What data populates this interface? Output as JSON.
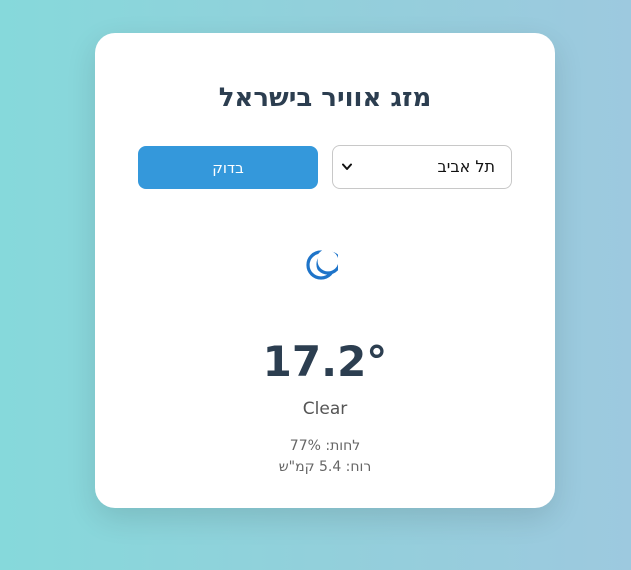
{
  "app": {
    "title": "מזג אוויר בישראל"
  },
  "controls": {
    "city_select": {
      "selected": "תל אביב"
    },
    "check_button_label": "בדוק"
  },
  "weather": {
    "icon": "crescent-moon-icon",
    "temperature": "17.2°",
    "description": "Clear",
    "humidity": "לחות: 77%",
    "wind": "רוח: 5.4 קמ\"ש"
  },
  "colors": {
    "accent": "#3498db",
    "heading": "#2c3e50",
    "icon": "#1e74c9"
  }
}
